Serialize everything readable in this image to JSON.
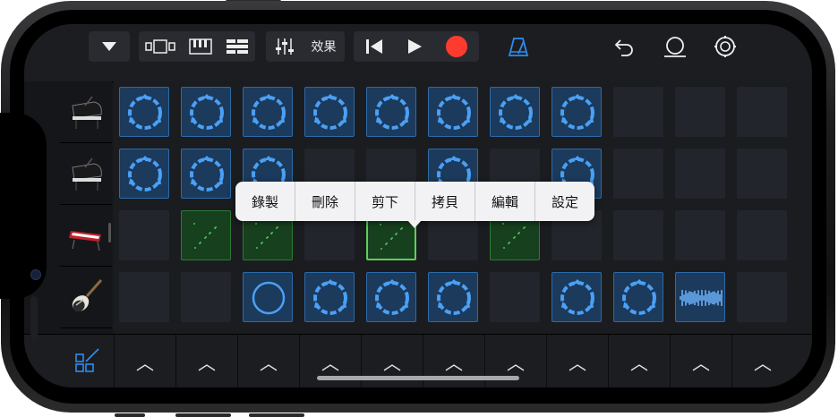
{
  "toolbar": {
    "effects_label": "效果",
    "icons": [
      "browser-dropdown-icon",
      "tracks-view-icon",
      "keyboard-icon",
      "grid-view-icon",
      "mixer-icon",
      "rewind-icon",
      "play-icon",
      "record-icon",
      "metronome-icon",
      "undo-icon",
      "loop-icon",
      "settings-icon"
    ]
  },
  "tracks": [
    {
      "instrument": "grand-piano"
    },
    {
      "instrument": "grand-piano"
    },
    {
      "instrument": "synth-keyboard"
    },
    {
      "instrument": "electric-guitar"
    }
  ],
  "cells": [
    [
      "blue-loop",
      "blue-loop",
      "blue-loop",
      "blue-loop",
      "blue-loop",
      "blue-loop",
      "blue-loop",
      "blue-loop",
      "empty",
      "empty",
      "empty"
    ],
    [
      "blue-loop",
      "blue-loop",
      "blue-loop",
      "empty",
      "empty",
      "blue-loop",
      "empty",
      "blue-loop",
      "empty",
      "empty",
      "empty"
    ],
    [
      "empty",
      "green",
      "green",
      "empty",
      "green-selected",
      "empty",
      "green",
      "empty",
      "empty",
      "empty",
      "empty"
    ],
    [
      "empty",
      "empty",
      "blue-ring",
      "blue-loop",
      "blue-loop",
      "blue-loop",
      "empty",
      "blue-loop",
      "blue-loop",
      "blue-wave",
      "empty"
    ]
  ],
  "popup_menu": {
    "items": [
      "錄製",
      "刪除",
      "剪下",
      "拷貝",
      "編輯",
      "設定"
    ]
  },
  "bottom": {
    "edit_icon": "grid-edit-icon",
    "chevron_glyph": "︿"
  },
  "colors": {
    "accent_blue": "#2d8cf0",
    "record_red": "#ff3b30",
    "loop_green": "#2d7a35"
  }
}
